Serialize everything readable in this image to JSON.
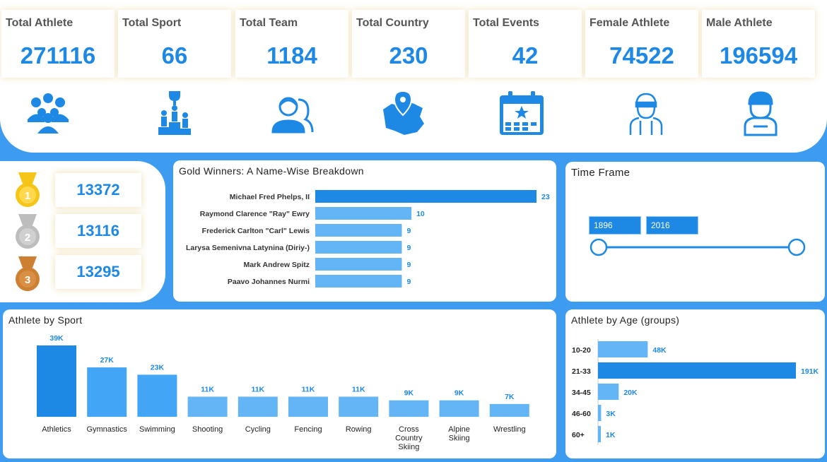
{
  "kpis": [
    {
      "label": "Total Athlete",
      "value": "271116"
    },
    {
      "label": "Total Sport",
      "value": "66"
    },
    {
      "label": "Total Team",
      "value": "1184"
    },
    {
      "label": "Total Country",
      "value": "230"
    },
    {
      "label": "Total Events",
      "value": "42"
    },
    {
      "label": "Female Athlete",
      "value": "74522"
    },
    {
      "label": "Male Athlete",
      "value": "196594"
    }
  ],
  "icons": [
    "athletes-group-icon",
    "podium-icon",
    "team-icon",
    "country-map-icon",
    "calendar-icon",
    "female-athlete-icon",
    "male-athlete-icon"
  ],
  "medals": [
    {
      "icon": "gold-medal-icon",
      "label": "1",
      "value": "13372",
      "color": "#f5c518"
    },
    {
      "icon": "silver-medal-icon",
      "label": "2",
      "value": "13116",
      "color": "#bdbdbd"
    },
    {
      "icon": "bronze-medal-icon",
      "label": "3",
      "value": "13295",
      "color": "#cd7f32"
    }
  ],
  "timeframe": {
    "title": "Time Frame",
    "start": "1896",
    "end": "2016"
  },
  "colors": {
    "accent": "#1e88e5",
    "bar_light": "#64b5f6",
    "background": "#3d9cf0"
  },
  "chart_data": [
    {
      "type": "bar",
      "orientation": "horizontal",
      "title": "Gold Winners: A Name-Wise Breakdown",
      "categories": [
        "Michael Fred Phelps, II",
        "Raymond Clarence \"Ray\" Ewry",
        "Frederick Carlton \"Carl\" Lewis",
        "Larysa Semenivna Latynina (Diriy-)",
        "Mark Andrew Spitz",
        "Paavo Johannes Nurmi"
      ],
      "values": [
        23,
        10,
        9,
        9,
        9,
        9
      ],
      "labels": [
        "23",
        "10",
        "9",
        "9",
        "9",
        "9"
      ]
    },
    {
      "type": "bar",
      "title": "Athlete by Sport",
      "categories": [
        "Athletics",
        "Gymnastics",
        "Swimming",
        "Shooting",
        "Cycling",
        "Fencing",
        "Rowing",
        "Cross Country Skiing",
        "Alpine Skiing",
        "Wrestling"
      ],
      "values": [
        39000,
        27000,
        23000,
        11000,
        11000,
        11000,
        11000,
        9000,
        9000,
        7000
      ],
      "labels": [
        "39K",
        "27K",
        "23K",
        "11K",
        "11K",
        "11K",
        "11K",
        "9K",
        "9K",
        "7K"
      ]
    },
    {
      "type": "bar",
      "orientation": "horizontal",
      "title": "Athlete by Age (groups)",
      "categories": [
        "10-20",
        "21-33",
        "34-45",
        "46-60",
        "60+"
      ],
      "values": [
        48000,
        191000,
        20000,
        3000,
        1000
      ],
      "labels": [
        "48K",
        "191K",
        "20K",
        "3K",
        "1K"
      ]
    }
  ]
}
